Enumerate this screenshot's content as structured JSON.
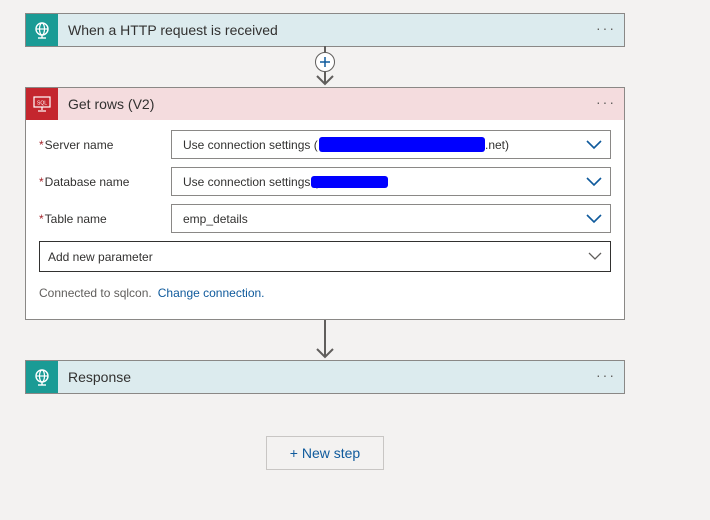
{
  "trigger": {
    "title": "When a HTTP request is received",
    "icon": "http-request-icon",
    "more_label": "···"
  },
  "add_step_icon": "plus-icon",
  "getrows": {
    "title": "Get rows (V2)",
    "icon": "sql-icon",
    "icon_text": "SQL",
    "more_label": "···",
    "fields": [
      {
        "required_mark": "*",
        "label": "Server name",
        "value_prefix": "Use connection settings (",
        "value_suffix": ".net)"
      },
      {
        "required_mark": "*",
        "label": "Database name",
        "value_prefix": "Use connection settings ("
      },
      {
        "required_mark": "*",
        "label": "Table name",
        "value": "emp_details"
      }
    ],
    "add_param_placeholder": "Add new parameter",
    "connected_text": "Connected to sqlcon.",
    "change_link": "Change connection."
  },
  "response": {
    "title": "Response",
    "icon": "http-response-icon",
    "more_label": "···"
  },
  "new_step_label": "+ New step",
  "colors": {
    "teal": "#1a9b95",
    "sql_red": "#c4262e",
    "link_blue": "#0f5a9c",
    "redaction": "#0000ff"
  }
}
